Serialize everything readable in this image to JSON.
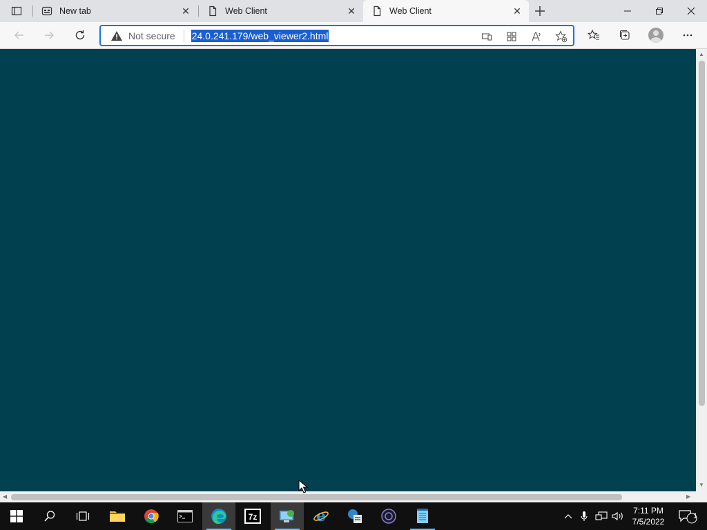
{
  "browser": {
    "tabs": [
      {
        "title": "New tab",
        "icon": "newtab-page-icon",
        "active": false
      },
      {
        "title": "Web Client",
        "icon": "page-icon",
        "active": false
      },
      {
        "title": "Web Client",
        "icon": "page-icon",
        "active": true
      }
    ],
    "address_bar": {
      "security_label": "Not secure",
      "url": "24.0.241.179/web_viewer2.html"
    }
  },
  "page": {
    "background_color": "#00404f"
  },
  "taskbar": {
    "apps": [
      {
        "name": "file-explorer-icon"
      },
      {
        "name": "chrome-icon"
      },
      {
        "name": "terminal-icon"
      },
      {
        "name": "edge-icon"
      },
      {
        "name": "7zip-icon"
      },
      {
        "name": "network-app-icon"
      },
      {
        "name": "internet-explorer-icon"
      },
      {
        "name": "settings-app-icon"
      },
      {
        "name": "obs-icon"
      },
      {
        "name": "notepad-icon"
      }
    ],
    "clock": {
      "time": "7:11 PM",
      "date": "7/5/2022"
    },
    "notifications_count": "1"
  },
  "colors": {
    "accent": "#1a73e8",
    "taskbar": "#101010",
    "page_bg": "#00404f"
  }
}
